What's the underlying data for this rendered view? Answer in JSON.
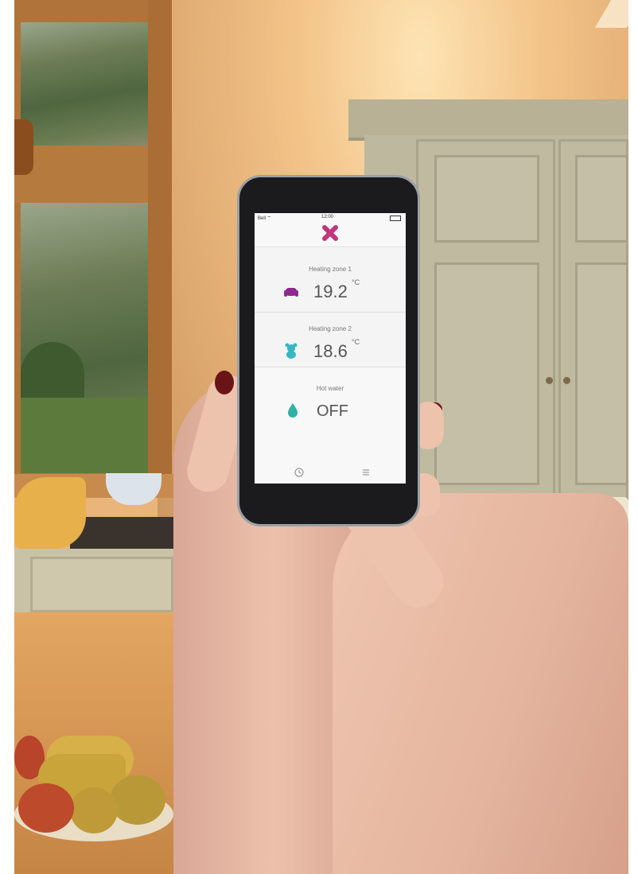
{
  "app": {
    "status_bar": {
      "carrier": "Bell ⌔",
      "time": "12:00"
    },
    "zones": [
      {
        "label": "Heating zone 1",
        "value": "19.2",
        "unit": "°C",
        "icon": "armchair-icon",
        "color": "#8e2a8f"
      },
      {
        "label": "Heating zone 2",
        "value": "18.6",
        "unit": "°C",
        "icon": "teddy-bear-icon",
        "color": "#38b6c4"
      },
      {
        "label": "Hot water",
        "value": "OFF",
        "icon": "water-drop-icon",
        "color": "#2fb1a5"
      }
    ],
    "bottom_bar": {
      "left_icon": "clock-icon",
      "right_icon": "menu-icon"
    },
    "brand_color": "#c2357f"
  }
}
